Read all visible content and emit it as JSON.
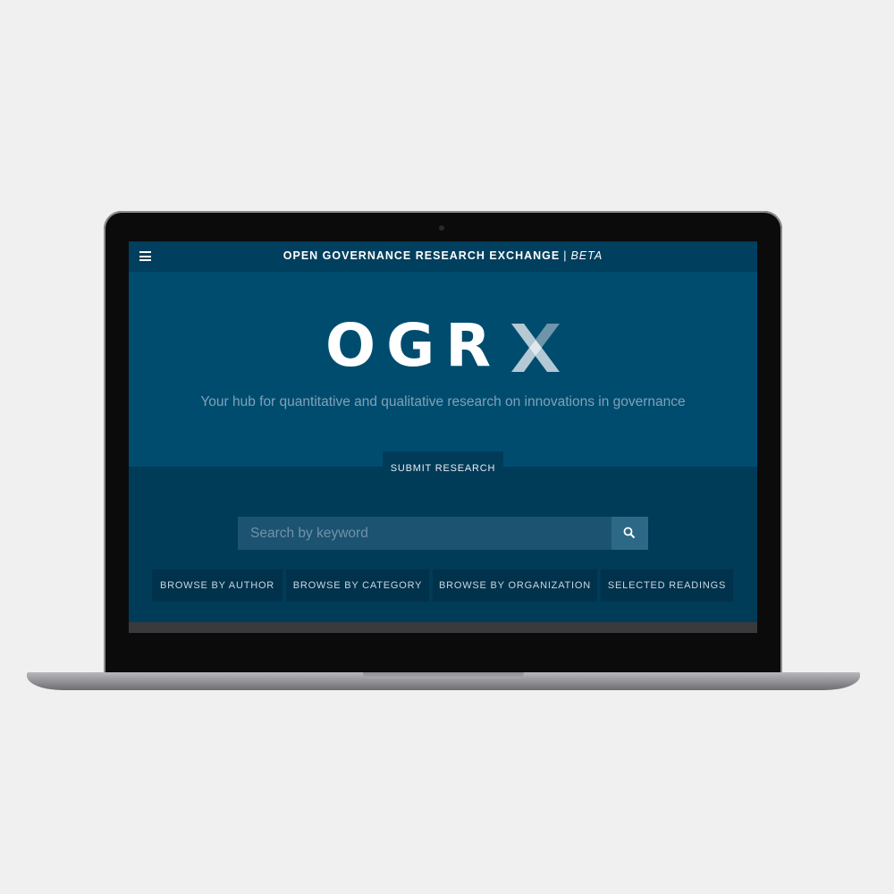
{
  "header": {
    "title": "OPEN GOVERNANCE RESEARCH EXCHANGE",
    "separator": "|",
    "beta": "BETA",
    "menu_icon": "hamburger-menu-icon"
  },
  "hero": {
    "logo_text": "OGR",
    "logo_x_icon": "x-logo-icon",
    "tagline": "Your hub for quantitative and qualitative research on innovations in governance"
  },
  "actions": {
    "submit_label": "SUBMIT RESEARCH"
  },
  "search": {
    "placeholder": "Search by keyword",
    "value": "",
    "button_icon": "search-icon"
  },
  "browse": [
    {
      "label": "BROWSE BY AUTHOR"
    },
    {
      "label": "BROWSE BY CATEGORY"
    },
    {
      "label": "BROWSE BY ORGANIZATION"
    },
    {
      "label": "SELECTED READINGS"
    }
  ],
  "colors": {
    "hero_bg": "#004c6f",
    "band_bg": "#003b58",
    "topbar_bg": "#003f5e",
    "button_bg": "#01324c",
    "logo_x_light": "#b4c9d4",
    "logo_x_mid": "#6f95a8"
  }
}
